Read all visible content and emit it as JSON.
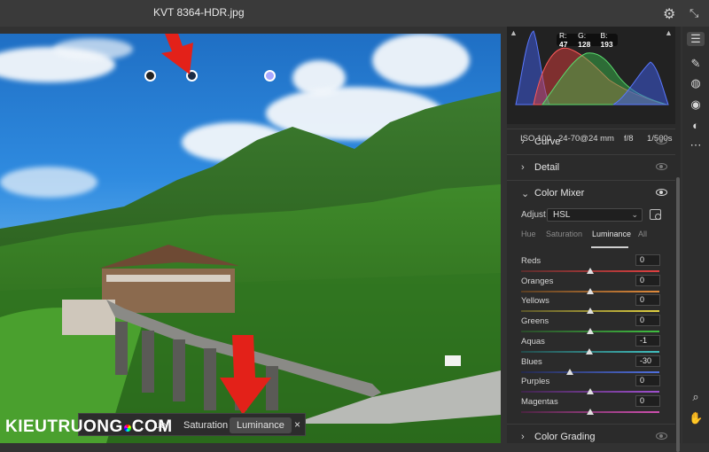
{
  "window": {
    "title": "KVT 8364-HDR.jpg"
  },
  "histogram": {
    "r_label": "R:",
    "r": "47",
    "g_label": "G:",
    "g": "128",
    "b_label": "B:",
    "b": "193"
  },
  "exif": {
    "iso": "ISO 100",
    "lens": "24-70@24 mm",
    "aperture": "f/8",
    "shutter": "1/500s"
  },
  "sections": {
    "curve": "Curve",
    "detail": "Detail",
    "color_mixer": "Color Mixer",
    "color_grading": "Color Grading"
  },
  "color_mixer": {
    "adjust_label": "Adjust",
    "adjust_value": "HSL",
    "tabs": [
      "Hue",
      "Saturation",
      "Luminance",
      "All"
    ],
    "active_tab": "Luminance",
    "sliders": [
      {
        "label": "Reds",
        "value": "0",
        "level": 0
      },
      {
        "label": "Oranges",
        "value": "0",
        "level": 0
      },
      {
        "label": "Yellows",
        "value": "0",
        "level": 0
      },
      {
        "label": "Greens",
        "value": "0",
        "level": 0
      },
      {
        "label": "Aquas",
        "value": "-1",
        "level": -1
      },
      {
        "label": "Blues",
        "value": "-30",
        "level": -30
      },
      {
        "label": "Purples",
        "value": "0",
        "level": 0
      },
      {
        "label": "Magentas",
        "value": "0",
        "level": 0
      }
    ]
  },
  "bottom_bar": {
    "tab_hue": "ue",
    "tab_saturation": "Saturation",
    "tab_luminance": "Luminance",
    "close": "×"
  },
  "watermark": {
    "before": "KIEUTRUONG",
    "after": "COM"
  },
  "colors": {
    "accent": "#e32119",
    "panel_bg": "#2b2b2b",
    "sky": "#2f8be0",
    "forest": "#2f6d23"
  },
  "icons": [
    "gear-icon",
    "collapse-icon",
    "sliders-icon",
    "brush-icon",
    "spot-heal-icon",
    "redeye-icon",
    "mask-icon",
    "more-icon",
    "zoom-icon",
    "hand-icon"
  ]
}
